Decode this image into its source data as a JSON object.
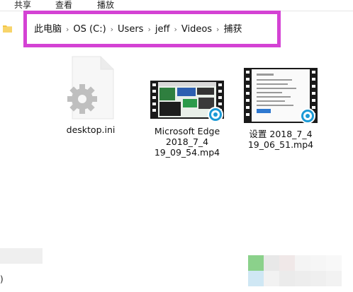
{
  "ribbon": {
    "tabs": [
      {
        "label": "共享"
      },
      {
        "label": "查看"
      },
      {
        "label": "播放"
      }
    ]
  },
  "address_bar": {
    "crumbs": [
      {
        "label": "此电脑"
      },
      {
        "label": "OS (C:)"
      },
      {
        "label": "Users"
      },
      {
        "label": "jeff"
      },
      {
        "label": "Videos"
      },
      {
        "label": "捕获"
      }
    ],
    "highlight_color": "#d442d4"
  },
  "files": [
    {
      "name": "desktop.ini",
      "icon": "settings-file-icon"
    },
    {
      "name": "Microsoft Edge\n2018_7_4\n19_09_54.mp4",
      "icon": "video-file-icon"
    },
    {
      "name": "设置 2018_7_4\n19_06_51.mp4",
      "icon": "video-file-icon"
    }
  ],
  "status": {
    "fragment": ")"
  }
}
